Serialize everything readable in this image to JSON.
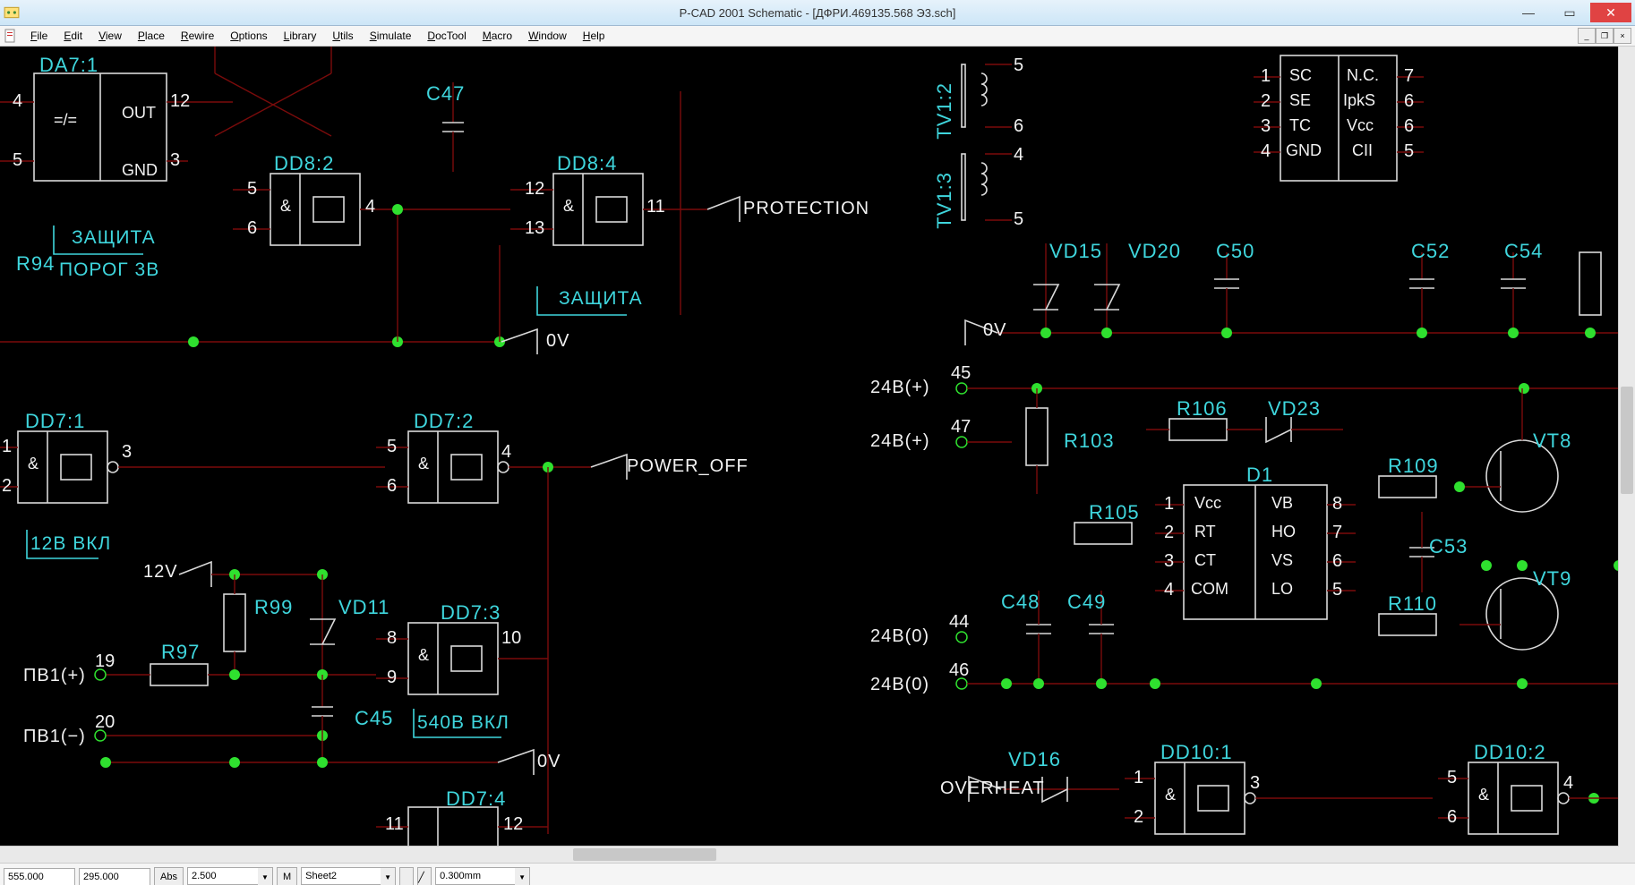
{
  "window": {
    "title": "P-CAD 2001 Schematic - [ДФРИ.469135.568 Э3.sch]"
  },
  "menu": {
    "items": [
      "File",
      "Edit",
      "View",
      "Place",
      "Rewire",
      "Options",
      "Library",
      "Utils",
      "Simulate",
      "DocTool",
      "Macro",
      "Window",
      "Help"
    ]
  },
  "status": {
    "x": "555.000",
    "y": "295.000",
    "abs": "Abs",
    "grid": "2.500",
    "m": "M",
    "sheet": "Sheet2",
    "linewidth": "0.300mm"
  },
  "sch": {
    "refs": {
      "DA7_1": "DA7:1",
      "DD8_2": "DD8:2",
      "DD8_4": "DD8:4",
      "DD7_1": "DD7:1",
      "DD7_2": "DD7:2",
      "DD7_3": "DD7:3",
      "DD7_4": "DD7:4",
      "DD10_1": "DD10:1",
      "DD10_2": "DD10:2",
      "C45": "C45",
      "C47": "C47",
      "C48": "C48",
      "C49": "C49",
      "C50": "C50",
      "C52": "C52",
      "C53": "C53",
      "C54": "C54",
      "R94": "R94",
      "R97": "R97",
      "R99": "R99",
      "R103": "R103",
      "R105": "R105",
      "R106": "R106",
      "R109": "R109",
      "R110": "R110",
      "VD11": "VD11",
      "VD15": "VD15",
      "VD16": "VD16",
      "VD20": "VD20",
      "VD23": "VD23",
      "VT8": "VT8",
      "VT9": "VT9",
      "TV1_2": "TV1:2",
      "TV1_3": "TV1:3",
      "D1": "D1"
    },
    "pins": {
      "p1": "1",
      "p2": "2",
      "p3": "3",
      "p4": "4",
      "p5": "5",
      "p6": "6",
      "p7": "7",
      "p8": "8",
      "p9": "9",
      "p10": "10",
      "p11": "11",
      "p12": "12",
      "p13": "13",
      "p19": "19",
      "p20": "20",
      "p44": "44",
      "p45": "45",
      "p46": "46",
      "p47": "47"
    },
    "labels": {
      "OUT": "OUT",
      "GND": "GND",
      "amp": "=/=",
      "ZASHITA": "ЗАЩИТА",
      "POROG3V": "ПОРОГ 3В",
      "ZASHITA2": "ЗАЩИТА",
      "twelveVKL": "12В ВКЛ",
      "fiveFortyVKL": "540В ВКЛ",
      "PROTECTION": "PROTECTION",
      "POWER_OFF": "POWER_OFF",
      "OV": "0V",
      "twelveV": "12V",
      "PV1P": "ПВ1(+)",
      "PV1M": "ПВ1(−)",
      "TWENTY4P": "24В(+)",
      "TWENTY4O": "24В(0)",
      "OVERHEAT": "OVERHEAT",
      "SC": "SC",
      "SE": "SE",
      "TC": "TC",
      "GND2": "GND",
      "NC": "N.C.",
      "IpkS": "IpkS",
      "Vcc": "Vcc",
      "CII": "CII",
      "Vcc2": "Vcc",
      "RT": "RT",
      "CT": "CT",
      "COM": "COM",
      "VB": "VB",
      "HO": "HO",
      "VS": "VS",
      "LO": "LO",
      "ampersand": "&"
    }
  }
}
